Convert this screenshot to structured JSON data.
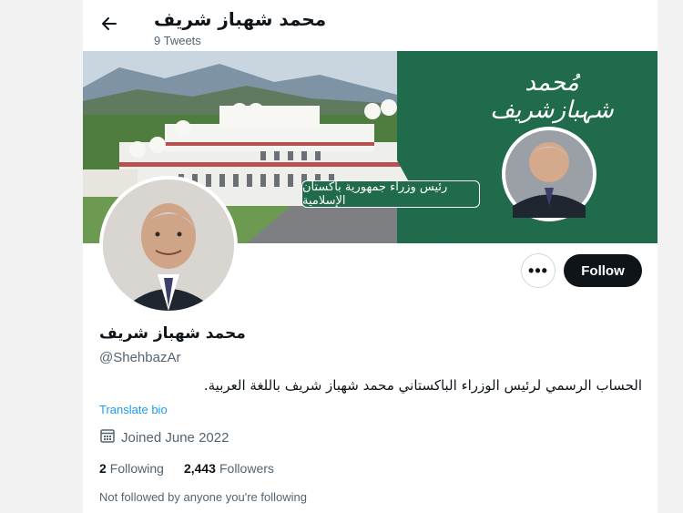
{
  "header": {
    "back_icon": "arrow-left-icon",
    "title": "محمد شهباز شريف",
    "subtitle": "9 Tweets"
  },
  "banner": {
    "calligraphy_name": "مُحمد شہبازشریف",
    "caption": "رئیس وزراء جمهوریة باكستان الإسلامية",
    "background_color": "#1f6b4c"
  },
  "actions": {
    "more_icon": "ellipsis-icon",
    "more_label": "•••",
    "follow_label": "Follow"
  },
  "profile": {
    "display_name": "محمد شهباز شريف",
    "handle": "@ShehbazAr",
    "bio": "الحساب الرسمي لرئيس الوزراء الباكستاني محمد شهباز شريف باللغة العربية.",
    "translate_label": "Translate bio",
    "joined_icon": "calendar-icon",
    "joined_text": "Joined June 2022",
    "following_count": "2",
    "following_label": "Following",
    "followers_count": "2,443",
    "followers_label": "Followers",
    "not_followed_text": "Not followed by anyone you're following"
  },
  "colors": {
    "accent_link": "#1d9bf0",
    "follow_button_bg": "#0f1419",
    "secondary_text": "#536471"
  }
}
